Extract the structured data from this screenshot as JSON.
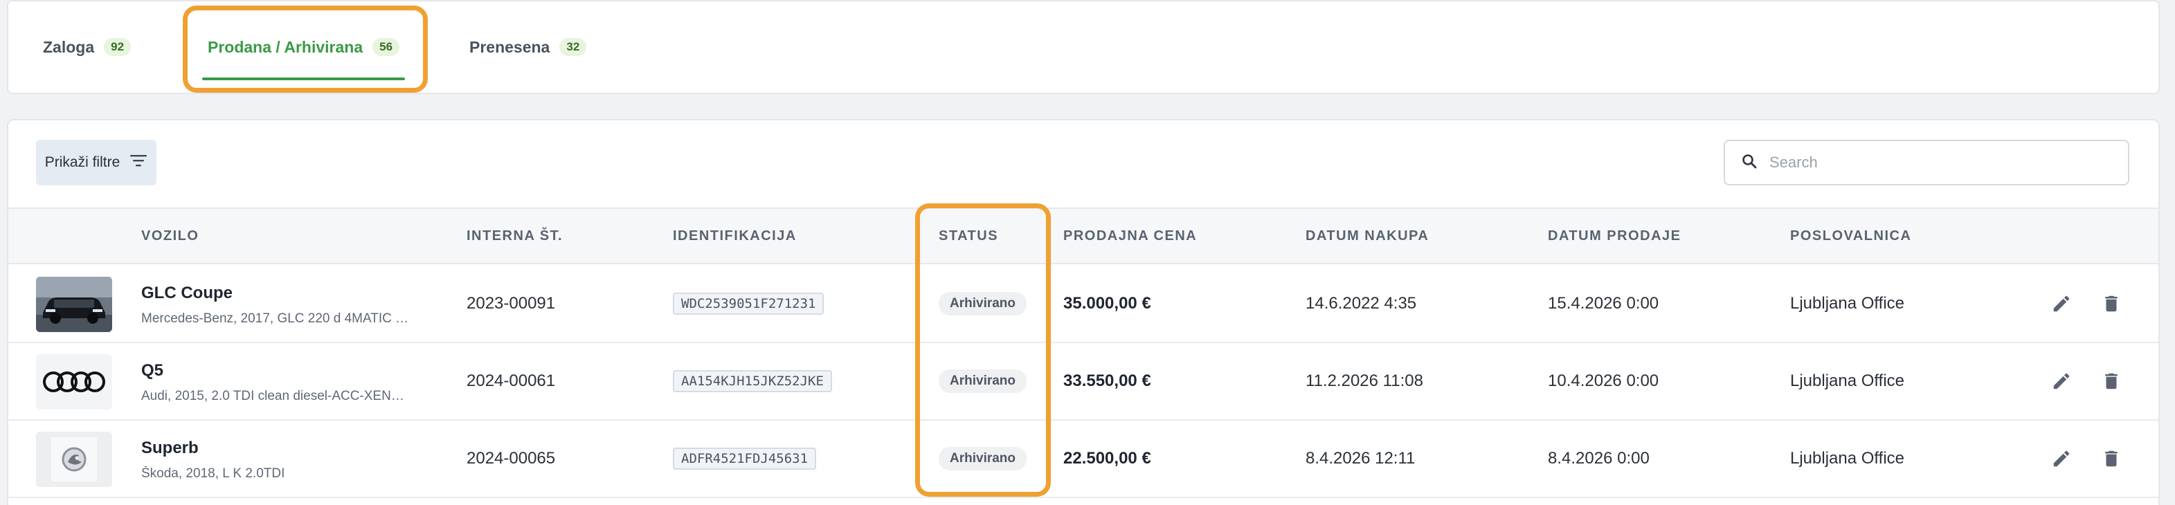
{
  "tabs": [
    {
      "label": "Zaloga",
      "count": "92"
    },
    {
      "label": "Prodana / Arhivirana",
      "count": "56"
    },
    {
      "label": "Prenesena",
      "count": "32"
    }
  ],
  "toolbar": {
    "filter_label": "Prikaži filtre",
    "search_placeholder": "Search"
  },
  "columns": {
    "vehicle": "VOZILO",
    "internal": "INTERNA ŠT.",
    "identification": "IDENTIFIKACIJA",
    "status": "STATUS",
    "price": "PRODAJNA CENA",
    "purchase_date": "DATUM NAKUPA",
    "sale_date": "DATUM PRODAJE",
    "branch": "POSLOVALNICA"
  },
  "rows": [
    {
      "name": "GLC Coupe",
      "desc": "Mercedes-Benz, 2017, GLC 220 d 4MATIC …",
      "internal": "2023-00091",
      "vin": "WDC2539051F271231",
      "status": "Arhivirano",
      "price": "35.000,00 €",
      "purchase_date": "14.6.2022 4:35",
      "sale_date": "15.4.2026 0:00",
      "branch": "Ljubljana Office",
      "thumb_icon": "car-photo"
    },
    {
      "name": "Q5",
      "desc": "Audi, 2015, 2.0 TDI clean diesel-ACC-XEN…",
      "internal": "2024-00061",
      "vin": "AA154KJH15JKZ52JKE",
      "status": "Arhivirano",
      "price": "33.550,00 €",
      "purchase_date": "11.2.2026 11:08",
      "sale_date": "10.4.2026 0:00",
      "branch": "Ljubljana Office",
      "thumb_icon": "audi-logo"
    },
    {
      "name": "Superb",
      "desc": "Škoda, 2018, L K 2.0TDI",
      "internal": "2024-00065",
      "vin": "ADFR4521FDJ45631",
      "status": "Arhivirano",
      "price": "22.500,00 €",
      "purchase_date": "8.4.2026 12:11",
      "sale_date": "8.4.2026 0:00",
      "branch": "Ljubljana Office",
      "thumb_icon": "skoda-logo"
    }
  ],
  "colors": {
    "accent": "#3a9a46",
    "highlight": "#f0a032",
    "badge_bg": "#e7f5dc"
  },
  "icons": {
    "filter": "filter-lines-icon",
    "search": "search-icon",
    "edit": "pencil-icon",
    "delete": "trash-icon"
  }
}
